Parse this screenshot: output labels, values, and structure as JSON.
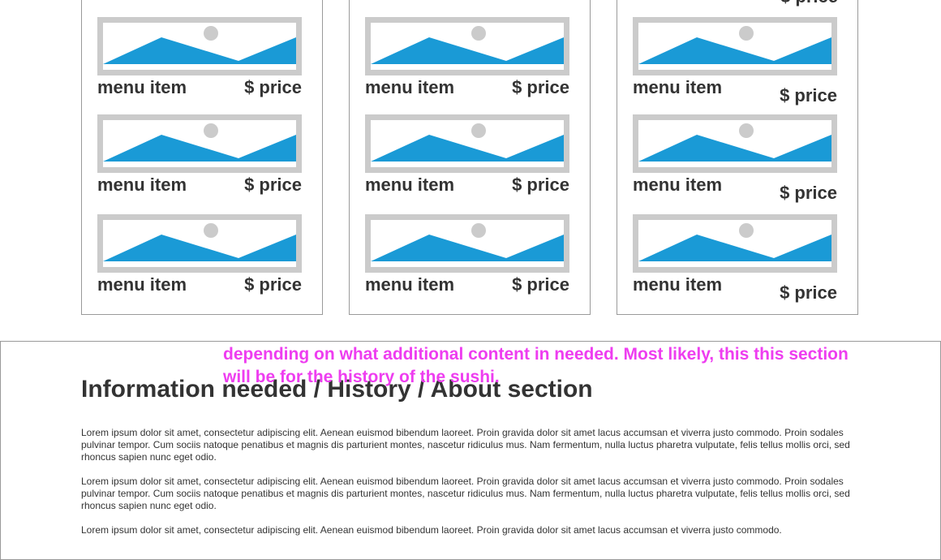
{
  "menu": {
    "columns": [
      {
        "items": [
          {
            "name": "menu item",
            "price": "$ price"
          },
          {
            "name": "menu item",
            "price": "$ price"
          },
          {
            "name": "menu item",
            "price": "$ price"
          }
        ]
      },
      {
        "items": [
          {
            "name": "menu item",
            "price": "$ price"
          },
          {
            "name": "menu item",
            "price": "$ price"
          },
          {
            "name": "menu item",
            "price": "$ price"
          }
        ]
      },
      {
        "top_price": "$ price",
        "items": [
          {
            "name": "menu item",
            "price": "$ price"
          },
          {
            "name": "menu item",
            "price": "$ price"
          },
          {
            "name": "menu item",
            "price": "$ price"
          }
        ]
      }
    ]
  },
  "info": {
    "note": "depending on what additional content in needed. Most likely, this this section will be for the history of the sushi.",
    "title": "Information needed / History / About section",
    "paragraphs": [
      "Lorem ipsum dolor sit amet, consectetur adipiscing elit. Aenean euismod bibendum laoreet. Proin gravida dolor sit amet lacus accumsan et viverra justo commodo. Proin sodales pulvinar tempor. Cum sociis natoque penatibus et magnis dis parturient montes, nascetur ridiculus mus. Nam fermentum, nulla luctus pharetra vulputate, felis tellus mollis orci, sed rhoncus sapien nunc eget odio.",
      "Lorem ipsum dolor sit amet, consectetur adipiscing elit. Aenean euismod bibendum laoreet. Proin gravida dolor sit amet lacus accumsan et viverra justo commodo. Proin sodales pulvinar tempor. Cum sociis natoque penatibus et magnis dis parturient montes, nascetur ridiculus mus. Nam fermentum, nulla luctus pharetra vulputate, felis tellus mollis orci, sed rhoncus sapien nunc eget odio.",
      "Lorem ipsum dolor sit amet, consectetur adipiscing elit. Aenean euismod bibendum laoreet. Proin gravida dolor sit amet lacus accumsan et viverra justo commodo."
    ]
  },
  "colors": {
    "placeholder_bg": "#cbcbcb",
    "mountain": "#1a9ad6",
    "sun": "#cbcbcb",
    "note": "#ee3df0",
    "text": "#333333"
  },
  "icons": {
    "image_placeholder": "image-placeholder-icon"
  }
}
